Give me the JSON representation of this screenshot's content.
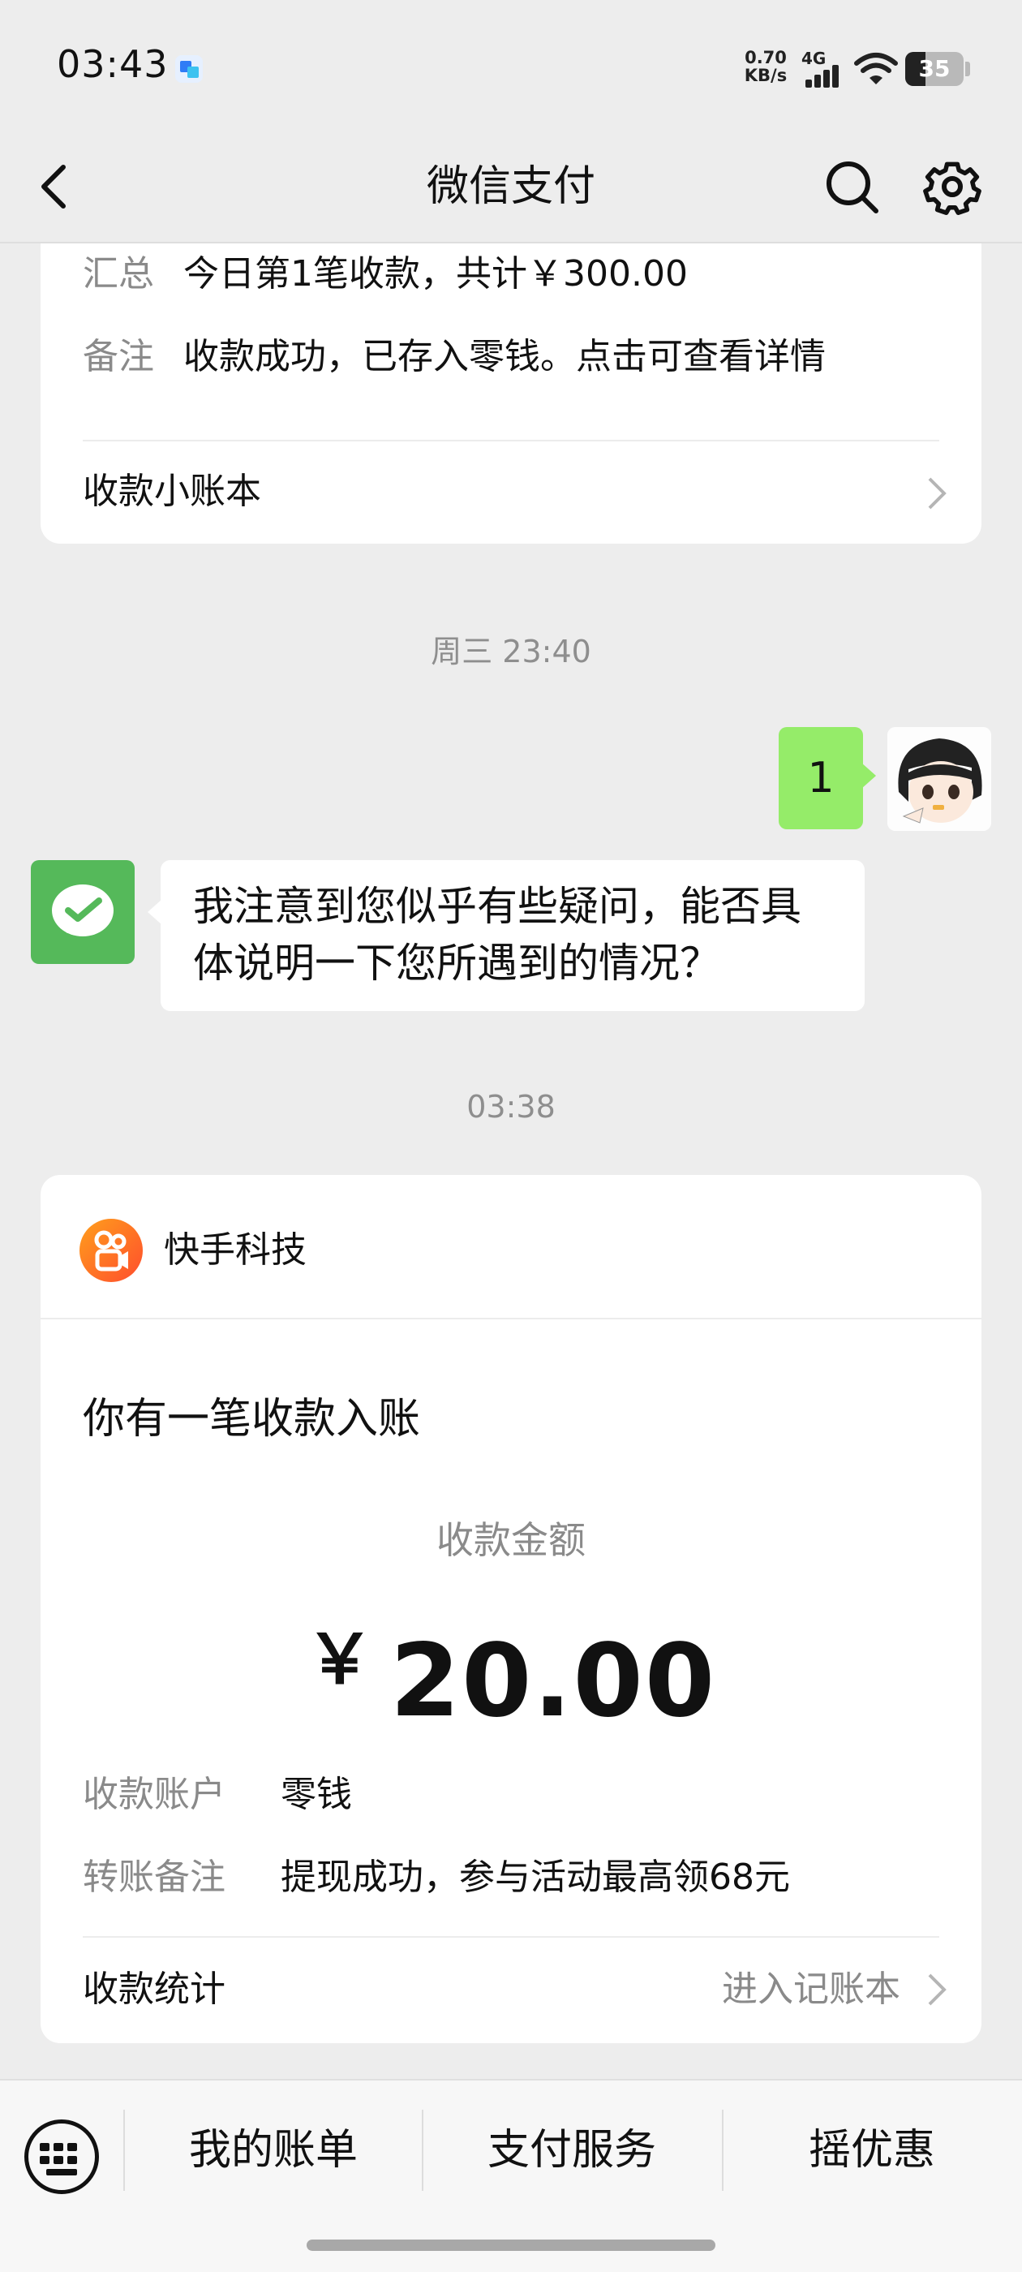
{
  "status_bar": {
    "time": "03:43",
    "net_speed_value": "0.70",
    "net_speed_unit": "KB/s",
    "network": "4G",
    "battery": "35"
  },
  "nav": {
    "title": "微信支付"
  },
  "top_card": {
    "summary_label": "汇总",
    "summary_value": "今日第1笔收款，共计￥300.00",
    "note_label": "备注",
    "note_value": "收款成功，已存入零钱。点击可查看详情",
    "link": "收款小账本"
  },
  "chat": {
    "time1": "周三 23:40",
    "my_message": "1",
    "reply_line1": "我注意到您似乎有些疑问，能否具",
    "reply_line2": "体说明一下您所遇到的情况？",
    "time2": "03:38"
  },
  "payment_card": {
    "merchant": "快手科技",
    "message": "你有一笔收款入账",
    "amount_label": "收款金额",
    "currency": "￥",
    "amount": "20.00",
    "account_label": "收款账户",
    "account_value": "零钱",
    "remark_label": "转账备注",
    "remark_value": "提现成功，参与活动最高领68元",
    "stats_label": "收款统计",
    "ledger_link": "进入记账本"
  },
  "bottom_bar": {
    "items": [
      "我的账单",
      "支付服务",
      "摇优惠"
    ]
  },
  "colors": {
    "wechat_green": "#55b95a",
    "my_bubble": "#95ec69"
  }
}
